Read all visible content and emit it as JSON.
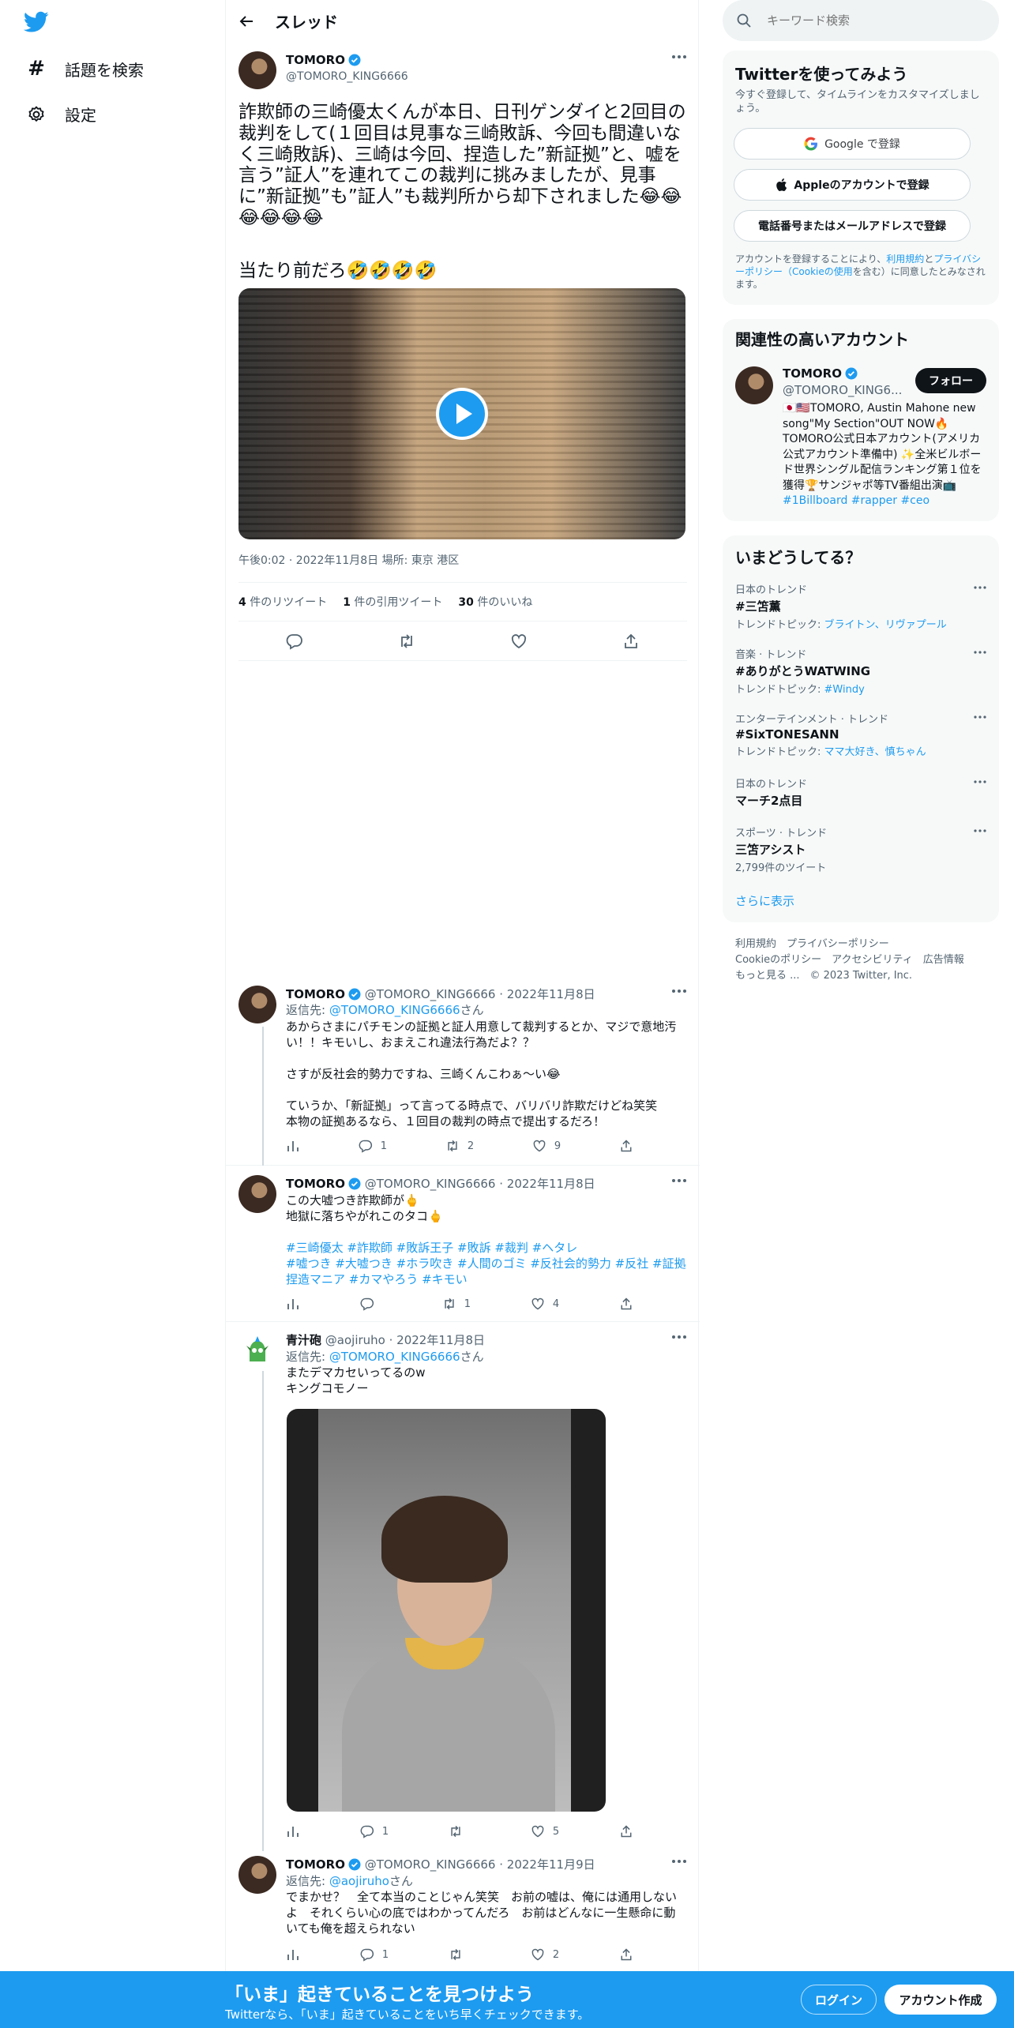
{
  "nav": {
    "explore_label": "話題を検索",
    "settings_label": "設定"
  },
  "header": {
    "title": "スレッド"
  },
  "main_tweet": {
    "author_name": "TOMORO",
    "handle": "@TOMORO_KING6666",
    "text": "詐欺師の三崎優太くんが本日、日刊ゲンダイと2回目の裁判をして(１回目は見事な三崎敗訴、今回も間違いなく三崎敗訴)、三崎は今回、捏造した”新証拠”と、嘘を言う”証人”を連れてこの裁判に挑みましたが、見事に”新証拠”も”証人”も裁判所から却下されました😂😂😂😂😂😂",
    "text2": "当たり前だろ🤣🤣🤣🤣",
    "meta": "午後0:02 · 2022年11月8日 場所: 東京 港区",
    "retweets_count": "4",
    "retweets_label": "件のリツイート",
    "quotes_count": "1",
    "quotes_label": "件の引用ツイート",
    "likes_count": "30",
    "likes_label": "件のいいね"
  },
  "replies": [
    {
      "author_name": "TOMORO",
      "handle": "@TOMORO_KING6666",
      "date": "· 2022年11月8日",
      "reply_prefix": "返信先: ",
      "reply_to": "@TOMORO_KING6666",
      "reply_suffix": "さん",
      "text": "あからさまにパチモンの証拠と証人用意して裁判するとか、マジで意地汚い！！キモいし、おまえこれ違法行為だよ？？\n\nさすが反社会的勢力ですね、三崎くんこわぁ〜い😂\n\nていうか、「新証拠」って言ってる時点で、バリバリ詐欺だけどね笑笑\n本物の証拠あるなら、１回目の裁判の時点で提出するだろ！",
      "replies": "1",
      "retweets": "2",
      "likes": "9"
    },
    {
      "author_name": "TOMORO",
      "handle": "@TOMORO_KING6666",
      "date": "· 2022年11月8日",
      "text": "この大嘘つき詐欺師が🖕\n地獄に落ちやがれこのタコ🖕",
      "hashtags": "#三崎優太 #詐欺師 #敗訴王子 #敗訴 #裁判 #ヘタレ\n#嘘つき #大嘘つき #ホラ吹き #人間のゴミ #反社会的勢力 #反社 #証拠捏造マニア #カマやろう #キモい",
      "replies": "",
      "retweets": "1",
      "likes": "4"
    },
    {
      "author_name": "青汁砲",
      "handle": "@aojiruho",
      "date": "· 2022年11月8日",
      "reply_prefix": "返信先: ",
      "reply_to": "@TOMORO_KING6666",
      "reply_suffix": "さん",
      "text": "またデマカセいってるのw\nキングコモノー",
      "replies": "1",
      "retweets": "",
      "likes": "5"
    },
    {
      "author_name": "TOMORO",
      "handle": "@TOMORO_KING6666",
      "date": "· 2022年11月9日",
      "reply_prefix": "返信先: ",
      "reply_to": "@aojiruho",
      "reply_suffix": "さん",
      "text": "でまかせ？　全て本当のことじゃん笑笑　お前の嘘は、俺には通用しないよ　それくらい心の底ではわかってんだろ　お前はどんなに一生懸命に動いても俺を超えられない",
      "replies": "1",
      "retweets": "",
      "likes": "2"
    }
  ],
  "right": {
    "search_placeholder": "キーワード検索",
    "signup": {
      "title": "Twitterを使ってみよう",
      "subtitle": "今すぐ登録して、タイムラインをカスタマイズしましょう。",
      "google_label": "Google で登録",
      "apple_label": "Appleのアカウントで登録",
      "phone_label": "電話番号またはメールアドレスで登録",
      "legal_pre": "アカウントを登録することにより、",
      "legal_terms": "利用規約",
      "legal_and": "と",
      "legal_privacy": "プライバシーポリシー（Cookieの使用",
      "legal_post": "を含む）に同意したとみなされます。"
    },
    "related": {
      "title": "関連性の高いアカウント",
      "name": "TOMORO",
      "handle": "@TOMORO_KING6...",
      "follow_label": "フォロー",
      "bio": "🇯🇵🇺🇸TOMORO, Austin Mahone new song\"My Section\"OUT NOW🔥TOMORO公式日本アカウント(アメリカ公式アカウント準備中) ✨全米ビルボード世界シングル配信ランキング第１位を獲得🏆サンジャポ等TV番組出演📺",
      "bio_tags": "#1Billboard #rapper #ceo"
    },
    "trends": {
      "title": "いまどうしてる？",
      "items": [
        {
          "context": "日本のトレンド",
          "name": "#三笘薫",
          "topic_label": "トレンドトピック: ",
          "topic": "ブライトン、リヴァプール"
        },
        {
          "context": "音楽 · トレンド",
          "name": "#ありがとうWATWING",
          "topic_label": "トレンドトピック: ",
          "topic": "#Windy"
        },
        {
          "context": "エンターテインメント · トレンド",
          "name": "#SixTONESANN",
          "topic_label": "トレンドトピック: ",
          "topic": "ママ大好き、慎ちゃん"
        },
        {
          "context": "日本のトレンド",
          "name": "マーチ2点目"
        },
        {
          "context": "スポーツ · トレンド",
          "name": "三笘アシスト",
          "count": "2,799件のツイート"
        }
      ],
      "show_more": "さらに表示"
    },
    "footer": {
      "l1": "利用規約　プライバシーポリシー",
      "l2": "Cookieのポリシー　アクセシビリティ　広告情報",
      "l3": "もっと見る ...　© 2023 Twitter, Inc."
    }
  },
  "bottom_bar": {
    "title": "「いま」起きていることを見つけよう",
    "subtitle": "Twitterなら、「いま」起きていることをいち早くチェックできます。",
    "login_label": "ログイン",
    "signup_label": "アカウント作成"
  },
  "colors": {
    "accent": "#1d9bf0",
    "text": "#0f1419",
    "muted": "#536471"
  }
}
